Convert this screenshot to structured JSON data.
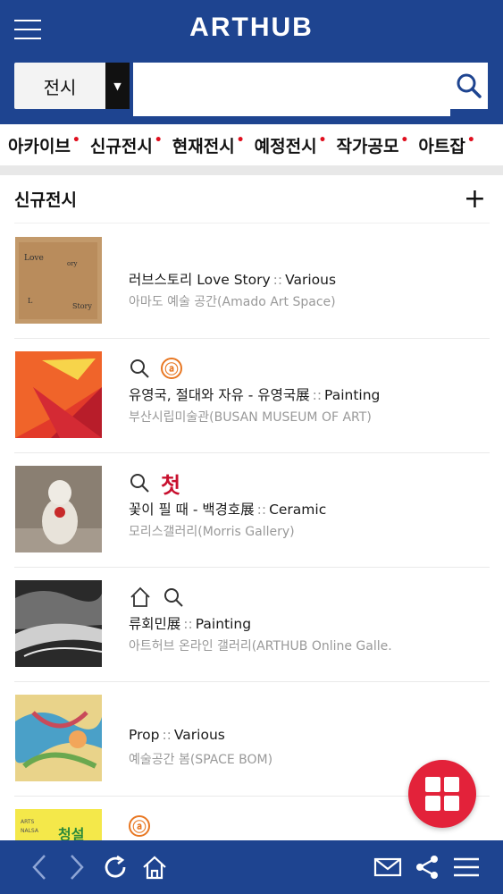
{
  "header": {
    "title": "ARTHUB",
    "menu_icon": "menu-icon",
    "category_select": {
      "value": "전시"
    },
    "search": {
      "value": "",
      "placeholder": "",
      "icon": "search-icon"
    }
  },
  "categories": [
    "아카이브",
    "신규전시",
    "현재전시",
    "예정전시",
    "작가공모",
    "아트잡"
  ],
  "section": {
    "title": "신규전시",
    "add_label": "+"
  },
  "items": [
    {
      "title": "러브스토리 Love Story",
      "separator": "::",
      "genre": "Various",
      "venue": "아마도 예술 공간(Amado Art Space)",
      "icons": []
    },
    {
      "title": "유영국, 절대와 자유 - 유영국展",
      "separator": "::",
      "genre": "Painting",
      "venue": "부산시립미술관(BUSAN MUSEUM OF ART)",
      "icons": [
        "search-icon",
        "a-badge-icon"
      ],
      "badge_a": "ⓐ"
    },
    {
      "title": "꽃이 필 때 - 백경호展",
      "separator": "::",
      "genre": "Ceramic",
      "venue": "모리스갤러리(Morris Gallery)",
      "icons": [
        "search-icon",
        "first-badge-icon"
      ],
      "badge_first": "첫"
    },
    {
      "title": "류회민展",
      "separator": "::",
      "genre": "Painting",
      "venue": "아트허브 온라인 갤러리(ARTHUB Online Galle.",
      "icons": [
        "home-icon",
        "search-icon"
      ]
    },
    {
      "title": "Prop",
      "separator": "::",
      "genre": "Various",
      "venue": "예술공간 봄(SPACE BOM)",
      "icons": []
    },
    {
      "title": "",
      "separator": "",
      "genre": "",
      "venue": "",
      "icons": [
        "a-badge-icon"
      ],
      "badge_a": "ⓐ"
    }
  ],
  "fab": {
    "icon": "grid-icon"
  },
  "bottom_bar": [
    "back-icon",
    "forward-icon",
    "refresh-icon",
    "home-icon",
    "mail-icon",
    "share-icon",
    "menu-icon"
  ],
  "colors": {
    "brand_blue": "#1e4490",
    "accent_red": "#e3223a",
    "badge_orange": "#e87722",
    "dot_red": "#e0101f"
  }
}
